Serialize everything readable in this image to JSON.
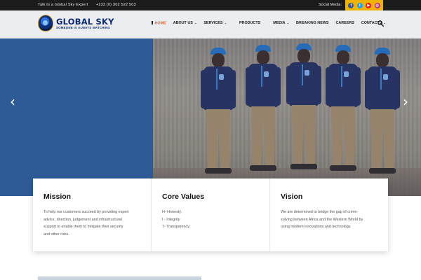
{
  "topbar": {
    "tagline": "Talk to a Global Sky Expert",
    "phone": "+233 (0) 302 522 503",
    "social_label": "Social Media:",
    "social_icons": [
      "facebook-icon",
      "twitter-icon",
      "youtube-icon",
      "instagram-icon"
    ]
  },
  "logo": {
    "title": "GLOBAL SKY",
    "tagline": "SOMEONE IS ALWAYS WATCHING"
  },
  "nav": {
    "items": [
      {
        "label": "HOME",
        "active": true
      },
      {
        "label": "ABOUT US",
        "dropdown": true
      },
      {
        "label": "SERVICES",
        "dropdown": true
      },
      {
        "label": "PRODUCTS"
      },
      {
        "label": "MEDIA",
        "dropdown": true
      },
      {
        "label": "BREAKING NEWS"
      },
      {
        "label": "CAREERS"
      },
      {
        "label": "CONTACTS",
        "dropdown": true
      }
    ],
    "search_icon": "search-icon"
  },
  "hero": {
    "prev_icon": "chevron-left-icon",
    "next_icon": "chevron-right-icon"
  },
  "cards": [
    {
      "title": "Mission",
      "text": "To help our customers succeed by providing expert\nadvice, direction, judgement and infrastructural\nsupport to enable them to mitigate their security\nand other risks."
    },
    {
      "title": "Core Values",
      "text": "H- Honesty.\nI - Integrity\nT- Transparency."
    },
    {
      "title": "Vision",
      "text": "We are determined to bridge the gap of crime-\nsolving between Africa and the Western World by\nusing modern innovations and technology."
    }
  ],
  "colors": {
    "accent": "#e8612c",
    "brand": "#0d2b7a",
    "hero_blue": "#2e5a96",
    "social_bar": "#f0b400"
  }
}
